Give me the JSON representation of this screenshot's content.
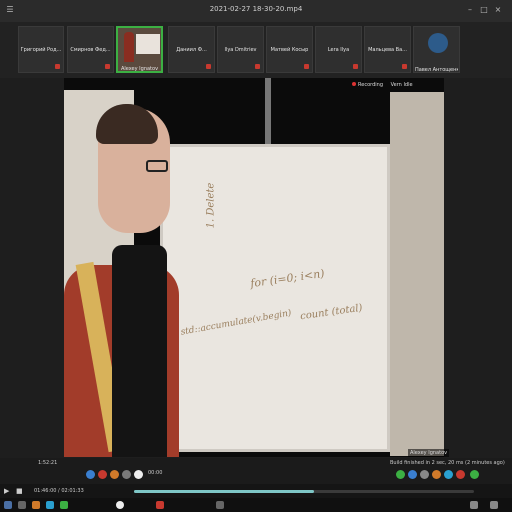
{
  "window": {
    "title": "2021-02-27 18-30-20.mp4",
    "controls": [
      "min-icon",
      "max-icon",
      "close-icon"
    ]
  },
  "participants": [
    {
      "name": "Павел Антощенко",
      "avatar": true
    },
    {
      "name": "Мальцева Ва...",
      "avatar": false
    },
    {
      "name": "Lera Ilya",
      "avatar": false
    },
    {
      "name": "Матвей Косыр",
      "avatar": false
    },
    {
      "name": "Ilya Dmitriev",
      "avatar": false
    },
    {
      "name": "Даниил Ф...",
      "avatar": false
    },
    {
      "name": "Григорий Род...",
      "avatar": false
    },
    {
      "name": "Смирнов Фед...",
      "avatar": false
    }
  ],
  "active_tile": {
    "label": "Alexey Ignatov"
  },
  "video": {
    "top_labels": [
      "Recording",
      "Vern Idle"
    ],
    "speaker_label": "Alexey Ignatov",
    "whiteboard_text": [
      "1. Delete",
      "for (i=0; i<n)",
      "count (total)",
      "std::accumulate(v.begin)"
    ]
  },
  "controls": {
    "left_time": "1:52:21",
    "timer": "00:00",
    "status": "Build finished in 2 sec, 20 ms (2 minutes ago)"
  },
  "player": {
    "time": "01:46:00 / 02:01:33",
    "progress": 0.53
  },
  "colors": {
    "accent": "#3cb043",
    "progress": "#7ec6c6",
    "mic_muted": "#c8392f"
  }
}
